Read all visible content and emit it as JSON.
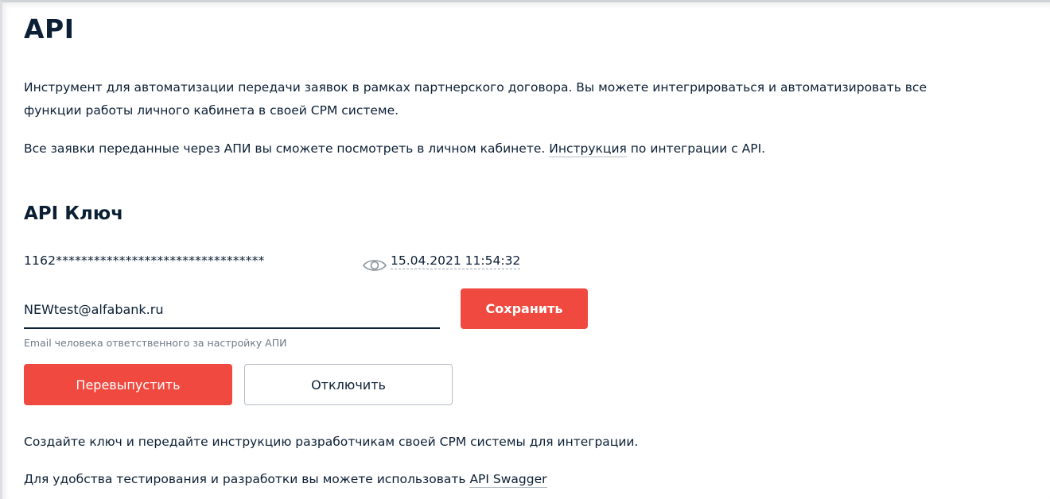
{
  "page": {
    "title": "API",
    "intro_line1": "Инструмент для автоматизации передачи заявок в рамках партнерского договора. Вы можете интегрироваться и автоматизировать все",
    "intro_line2": "функции работы личного кабинета в своей CPM системе.",
    "requests_text_before": "Все заявки переданные через АПИ вы сможете посмотреть в личном кабинете. ",
    "requests_link": "Инструкция",
    "requests_text_after": " по интеграции с API."
  },
  "api_key": {
    "heading": "API Ключ",
    "masked_key": "1162*********************************",
    "created_at": "15.04.2021 11:54:32",
    "eye_icon": "eye-icon"
  },
  "email": {
    "value": "NEWtest@alfabank.ru",
    "helper": "Email человека ответственного за настройку АПИ"
  },
  "buttons": {
    "save": "Сохранить",
    "reissue": "Перевыпустить",
    "disable": "Отключить"
  },
  "footer": {
    "create_key_text": "Создайте ключ и передайте инструкцию разработчикам своей CPM системы для интеграции.",
    "swagger_text_before": "Для удобства тестирования и разработки вы можете использовать ",
    "swagger_link": "API Swagger"
  },
  "colors": {
    "primary": "#f04a40",
    "text": "#0b1f35",
    "muted": "#6d7986"
  }
}
